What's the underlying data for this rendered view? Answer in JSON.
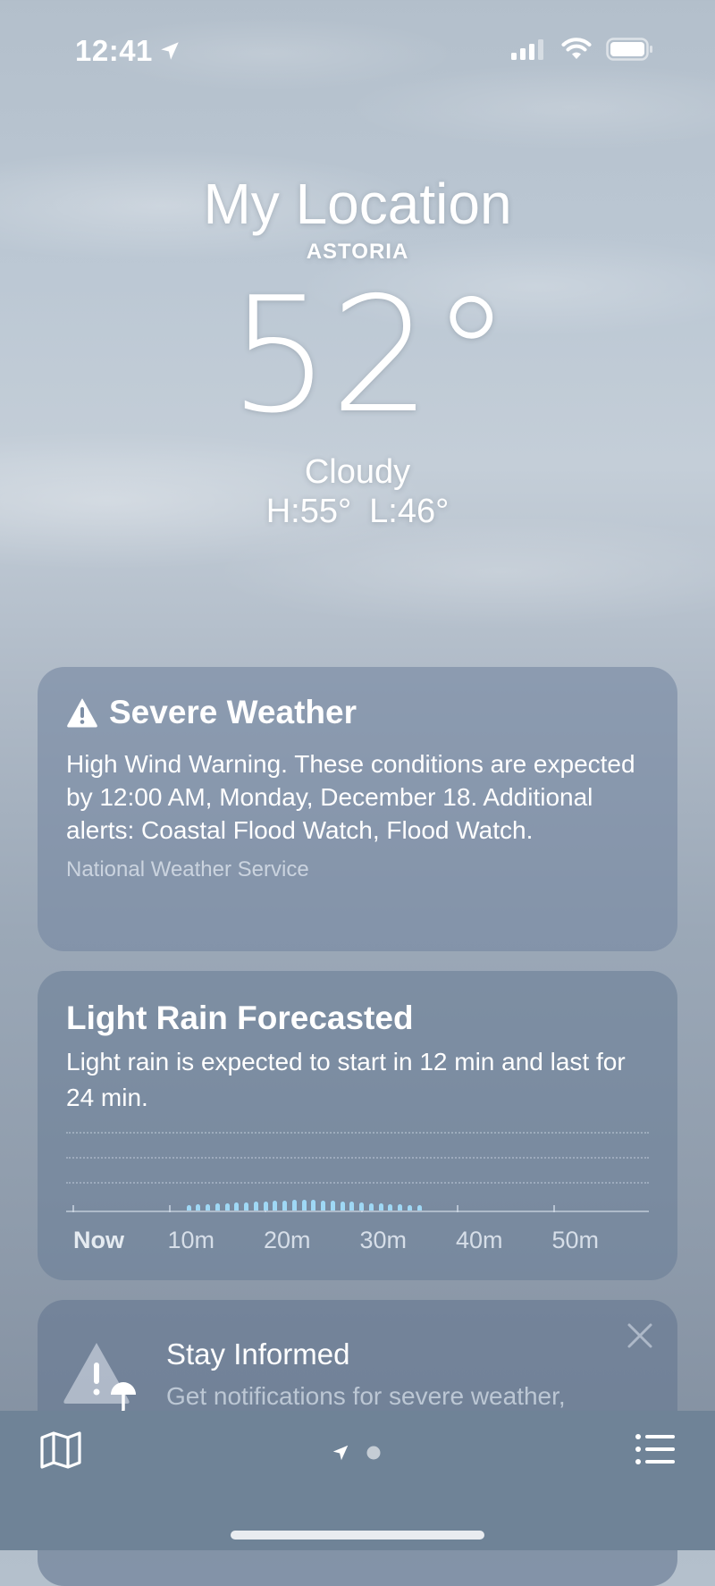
{
  "status_bar": {
    "time": "12:41",
    "icons": [
      "location-arrow-icon",
      "cellular-signal-icon",
      "wifi-icon",
      "battery-icon"
    ]
  },
  "header": {
    "title": "My Location",
    "subtitle": "ASTORIA",
    "temperature": "52°",
    "condition": "Cloudy",
    "high": "H:55°",
    "low": "L:46°"
  },
  "severe_card": {
    "icon": "warning-triangle-icon",
    "title": "Severe Weather",
    "body": "High Wind Warning. These conditions are expected by 12:00 AM, Monday, December 18. Additional alerts: Coastal Flood Watch, Flood Watch.",
    "source": "National Weather Service"
  },
  "rain_card": {
    "title": "Light Rain Forecasted",
    "body": "Light rain is expected to start in 12 min and last for 24 min."
  },
  "chart_data": {
    "type": "bar",
    "title": "",
    "x_ticks": [
      "Now",
      "10m",
      "20m",
      "30m",
      "40m",
      "50m"
    ],
    "x_range_minutes": [
      0,
      60
    ],
    "grid": true,
    "intensity_range": [
      0,
      1
    ],
    "series": [
      {
        "minutes": [
          12,
          13,
          14,
          15,
          16,
          17,
          18,
          19,
          20,
          21,
          22,
          23,
          24,
          25,
          26,
          27,
          28,
          29,
          30,
          31,
          32,
          33,
          34,
          35,
          36
        ],
        "values": [
          0.06,
          0.07,
          0.07,
          0.08,
          0.08,
          0.09,
          0.09,
          0.1,
          0.1,
          0.11,
          0.11,
          0.12,
          0.12,
          0.12,
          0.11,
          0.11,
          0.1,
          0.1,
          0.09,
          0.08,
          0.08,
          0.07,
          0.07,
          0.06,
          0.06
        ]
      }
    ],
    "bar_color": "#9fd8f5"
  },
  "inform_card": {
    "title": "Stay Informed",
    "body": "Get notifications for severe weather, rain, and snow near you.",
    "icons": [
      "warning-umbrella-icon",
      "close-icon"
    ]
  },
  "bottom_bar": {
    "icons": [
      "map-icon",
      "location-arrow-icon",
      "page-dot-icon",
      "list-icon"
    ]
  }
}
